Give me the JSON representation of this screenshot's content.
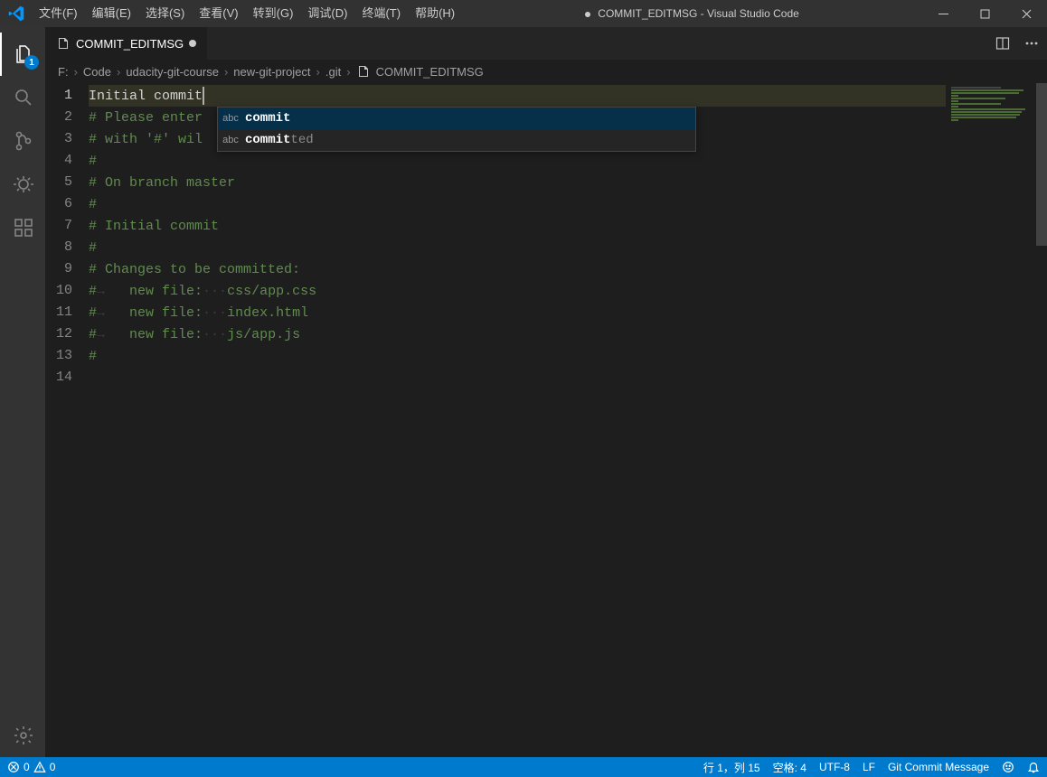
{
  "title": "COMMIT_EDITMSG - Visual Studio Code",
  "menus": [
    "文件(F)",
    "编辑(E)",
    "选择(S)",
    "查看(V)",
    "转到(G)",
    "调试(D)",
    "终端(T)",
    "帮助(H)"
  ],
  "activity_badge": "1",
  "tab": {
    "label": "COMMIT_EDITMSG"
  },
  "breadcrumbs": [
    "F:",
    "Code",
    "udacity-git-course",
    "new-git-project",
    ".git",
    "COMMIT_EDITMSG"
  ],
  "line_numbers": [
    "1",
    "2",
    "3",
    "4",
    "5",
    "6",
    "7",
    "8",
    "9",
    "10",
    "11",
    "12",
    "13",
    "14"
  ],
  "lines": {
    "l1": "Initial commit",
    "l2_pre": "# Please enter",
    "l3_pre": "# with '#' wil",
    "l4": "#",
    "l5": "# On branch master",
    "l6": "#",
    "l7": "# Initial commit",
    "l8": "#",
    "l9": "# Changes to be committed:",
    "l10_a": "#",
    "l10_b": "new file:",
    "l10_c": "css/app.css",
    "l11_a": "#",
    "l11_b": "new file:",
    "l11_c": "index.html",
    "l12_a": "#",
    "l12_b": "new file:",
    "l12_c": "js/app.js",
    "l13": "#"
  },
  "suggest": {
    "kind": "abc",
    "items": [
      {
        "match": "commit",
        "rest": ""
      },
      {
        "match": "commit",
        "rest": "ted"
      }
    ]
  },
  "status": {
    "errors": "0",
    "warnings": "0",
    "cursor": "行 1，列 15",
    "spaces": "空格: 4",
    "encoding": "UTF-8",
    "eol": "LF",
    "language": "Git Commit Message"
  }
}
